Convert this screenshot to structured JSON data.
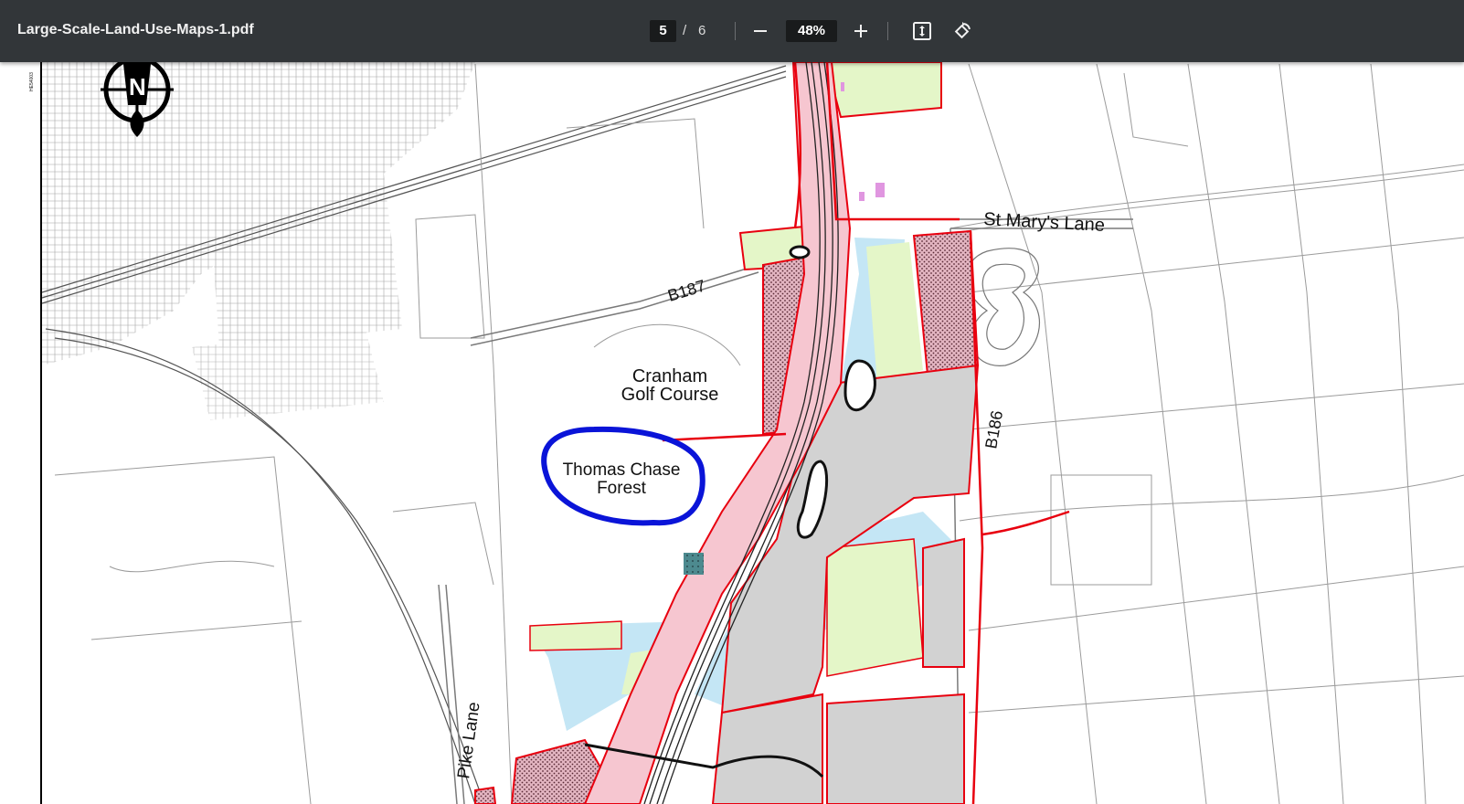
{
  "toolbar": {
    "file_name": "Large-Scale-Land-Use-Maps-1.pdf",
    "current_page": "5",
    "page_separator": "/",
    "total_pages": "6",
    "zoom": "48%",
    "icons": {
      "zoom_out": "minus-icon",
      "zoom_in": "plus-icon",
      "fit": "fit-to-page-icon",
      "rotate": "rotate-icon"
    }
  },
  "map": {
    "labels": {
      "st_marys_lane": "St Mary's Lane",
      "b187": "B187",
      "b186": "B186",
      "cranham_1": "Cranham",
      "cranham_2": "Golf Course",
      "thomas_1": "Thomas Chase",
      "thomas_2": "Forest",
      "pike_lane": "Pike Lane"
    },
    "colors": {
      "boundary_red": "#e8000f",
      "highlight_blue": "#0a14d8",
      "pink_fill": "#f6c6d0",
      "green_fill": "#e4f6c8",
      "blue_fill": "#c4e6f5",
      "grey_fill": "#d2d2d2",
      "hatch_fill": "#d9a8b4"
    }
  }
}
